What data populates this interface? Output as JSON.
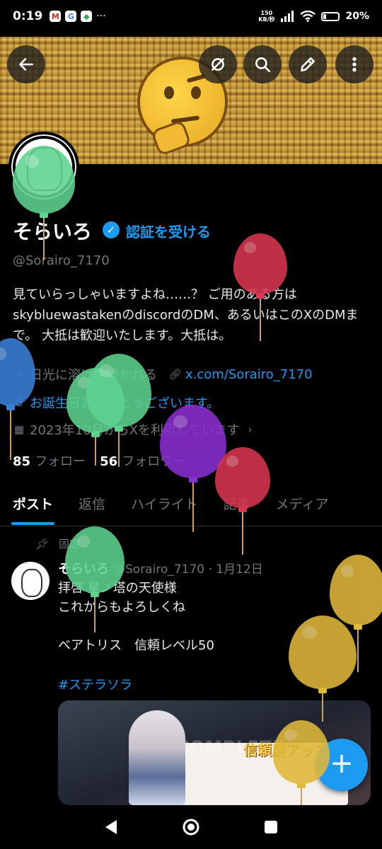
{
  "status_bar": {
    "time": "0:19",
    "notif_icons": [
      "M",
      "G",
      "◆"
    ],
    "more": "···",
    "net_speed_value": "150",
    "net_speed_unit": "KB/秒",
    "battery": "20%"
  },
  "header": {
    "back_icon": "arrow-left-icon",
    "grok_icon": "grok-slash-icon",
    "search_icon": "search-icon",
    "edit_icon": "pencil-icon",
    "more_icon": "more-vertical-icon"
  },
  "profile": {
    "name": "そらいろ",
    "verify_link": "認証を受ける",
    "handle": "@Sorairo_7170",
    "bio": "見ていらっしゃいますよね……？ ご用のある方はskybluewastakenのdiscordのDM、あるいはこのXのDMまで。 大抵は歓迎いたします。大抵は。",
    "location": "日光に溶けて焼かれる",
    "website": "x.com/Sorairo_7170",
    "birthday": "お誕生日おめでとうございます。",
    "joined": "2023年10月からXを利用しています",
    "following_count": "85",
    "following_label": "フォロー",
    "followers_count": "56",
    "followers_label": "フォロワー"
  },
  "tabs": [
    {
      "label": "ポスト"
    },
    {
      "label": "返信"
    },
    {
      "label": "ハイライト"
    },
    {
      "label": "記事"
    },
    {
      "label": "メディア"
    }
  ],
  "pinned_post": {
    "pinned_label": "固定",
    "author": "そらいろ",
    "handle_date": "@Sorairo_7170 · 1月12日",
    "body": "拝啓 星ノ塔の天使様\nこれからもよろしくね\n\nベアトリス　信頼レベル50",
    "hashtag": "#ステラソラ",
    "media_text_complete": "COMPLETE",
    "media_text_banner": "信頼度アップ"
  },
  "fab_label": "+",
  "colors": {
    "accent": "#1d9bf0",
    "background": "#000000",
    "balloon_green": "#5ed38f",
    "balloon_red": "#d9364f",
    "balloon_purple": "#8a2fd0",
    "balloon_blue": "#3a7fd6",
    "balloon_yellow": "#e0b83a"
  }
}
